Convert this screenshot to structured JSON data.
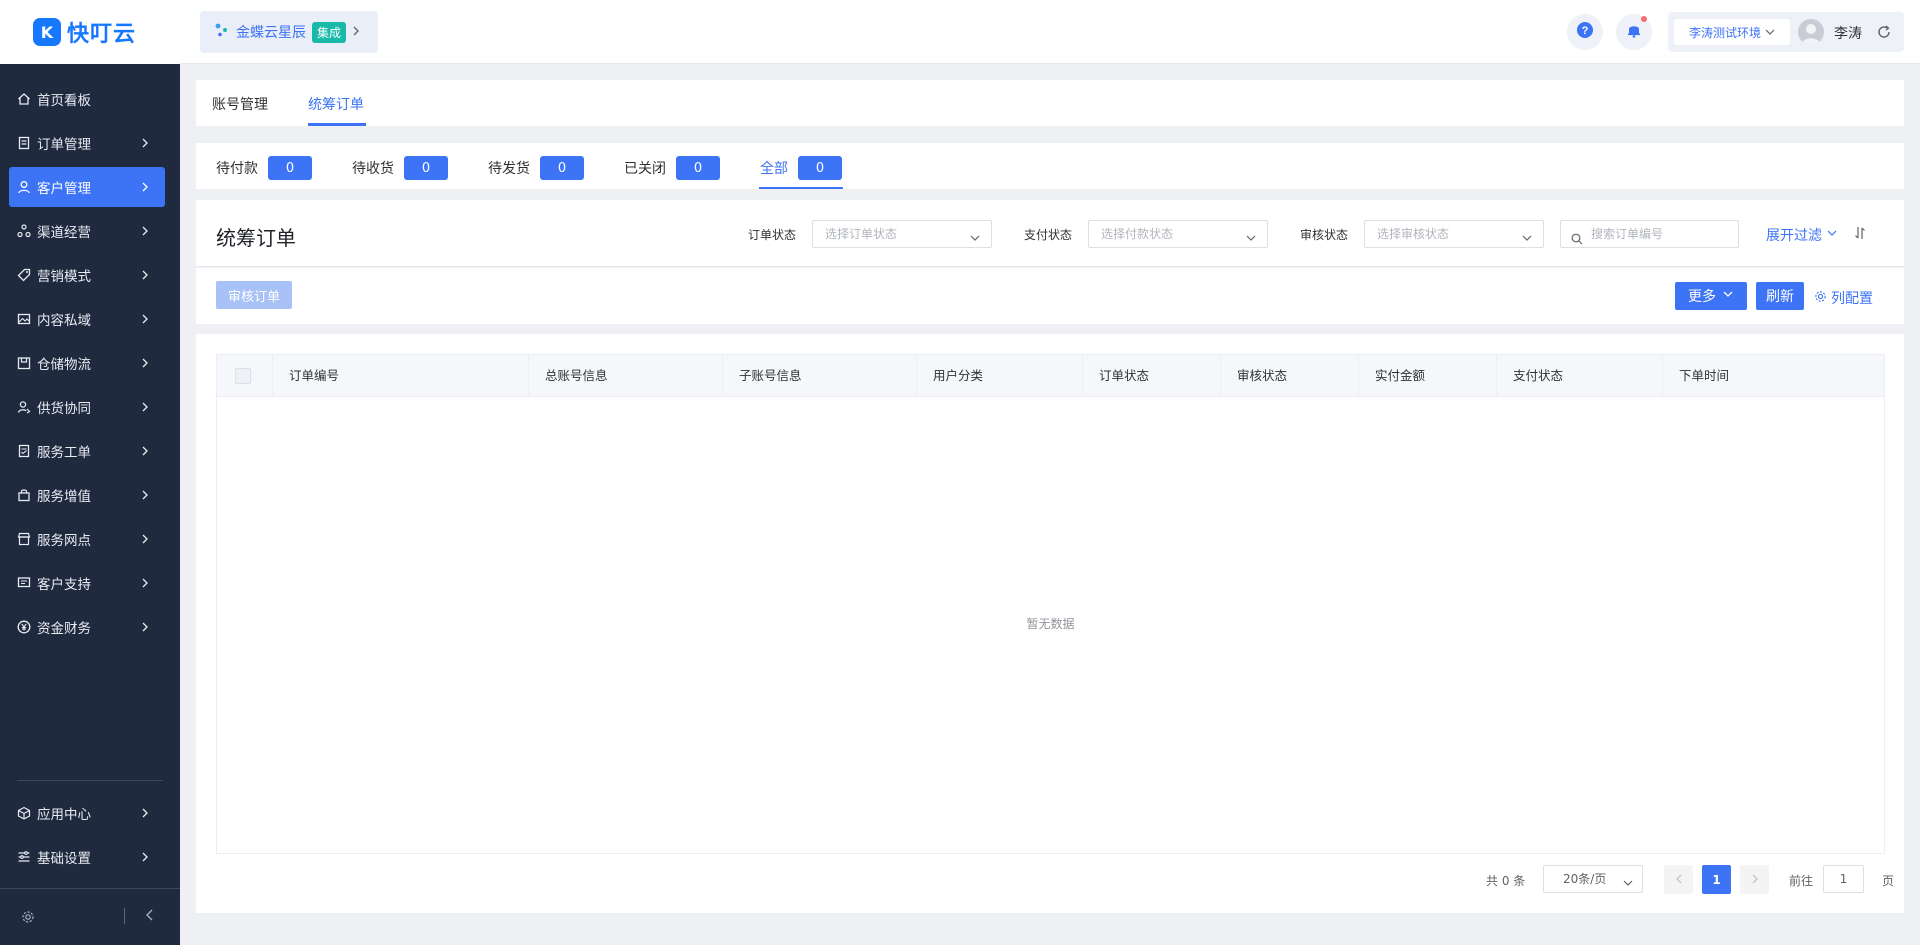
{
  "app": {
    "logo_text": "快叮云",
    "logo_glyph": "K"
  },
  "sidebar": {
    "items": [
      {
        "label": "首页看板",
        "icon": "home-icon",
        "has_arrow": false
      },
      {
        "label": "订单管理",
        "icon": "order-icon",
        "has_arrow": true
      },
      {
        "label": "客户管理",
        "icon": "user-icon",
        "has_arrow": true,
        "active": true
      },
      {
        "label": "渠道经营",
        "icon": "channel-icon",
        "has_arrow": true
      },
      {
        "label": "营销模式",
        "icon": "tag-icon",
        "has_arrow": true
      },
      {
        "label": "内容私域",
        "icon": "image-icon",
        "has_arrow": true
      },
      {
        "label": "仓储物流",
        "icon": "warehouse-icon",
        "has_arrow": true
      },
      {
        "label": "供货协同",
        "icon": "supply-icon",
        "has_arrow": true
      },
      {
        "label": "服务工单",
        "icon": "ticket-icon",
        "has_arrow": true
      },
      {
        "label": "服务增值",
        "icon": "bag-icon",
        "has_arrow": true
      },
      {
        "label": "服务网点",
        "icon": "store-icon",
        "has_arrow": true
      },
      {
        "label": "客户支持",
        "icon": "support-icon",
        "has_arrow": true
      },
      {
        "label": "资金财务",
        "icon": "yen-icon",
        "has_arrow": true
      }
    ],
    "bottom_items": [
      {
        "label": "应用中心",
        "icon": "cube-icon"
      },
      {
        "label": "基础设置",
        "icon": "settings-list-icon"
      }
    ]
  },
  "header": {
    "integration_name": "金蝶云星辰",
    "integration_badge": "集成",
    "env_label": "李涛测试环境",
    "user_name": "李涛"
  },
  "tabs": [
    "账号管理",
    "统筹订单"
  ],
  "status_tabs": [
    {
      "label": "待付款",
      "count": "0"
    },
    {
      "label": "待收货",
      "count": "0"
    },
    {
      "label": "待发货",
      "count": "0"
    },
    {
      "label": "已关闭",
      "count": "0"
    },
    {
      "label": "全部",
      "count": "0"
    }
  ],
  "filters": {
    "page_title": "统筹订单",
    "order_status_label": "订单状态",
    "order_status_placeholder": "选择订单状态",
    "pay_status_label": "支付状态",
    "pay_status_placeholder": "选择付款状态",
    "audit_status_label": "审核状态",
    "audit_status_placeholder": "选择审核状态",
    "search_placeholder": "搜索订单编号",
    "expand_label": "展开过滤"
  },
  "actions": {
    "audit_button": "审核订单",
    "more_button": "更多",
    "refresh_button": "刷新",
    "column_config": "列配置"
  },
  "table": {
    "columns": [
      "订单编号",
      "总账号信息",
      "子账号信息",
      "用户分类",
      "订单状态",
      "审核状态",
      "实付金额",
      "支付状态",
      "下单时间"
    ],
    "empty_text": "暂无数据"
  },
  "pagination": {
    "total_text": "共 0 条",
    "page_size": "20条/页",
    "current_page": "1",
    "goto_label": "前往",
    "goto_value": "1",
    "page_suffix": "页"
  },
  "colors": {
    "primary": "#3d73f5",
    "sidebar_bg": "#1f2a3f",
    "teal_badge": "#18b9a8"
  }
}
